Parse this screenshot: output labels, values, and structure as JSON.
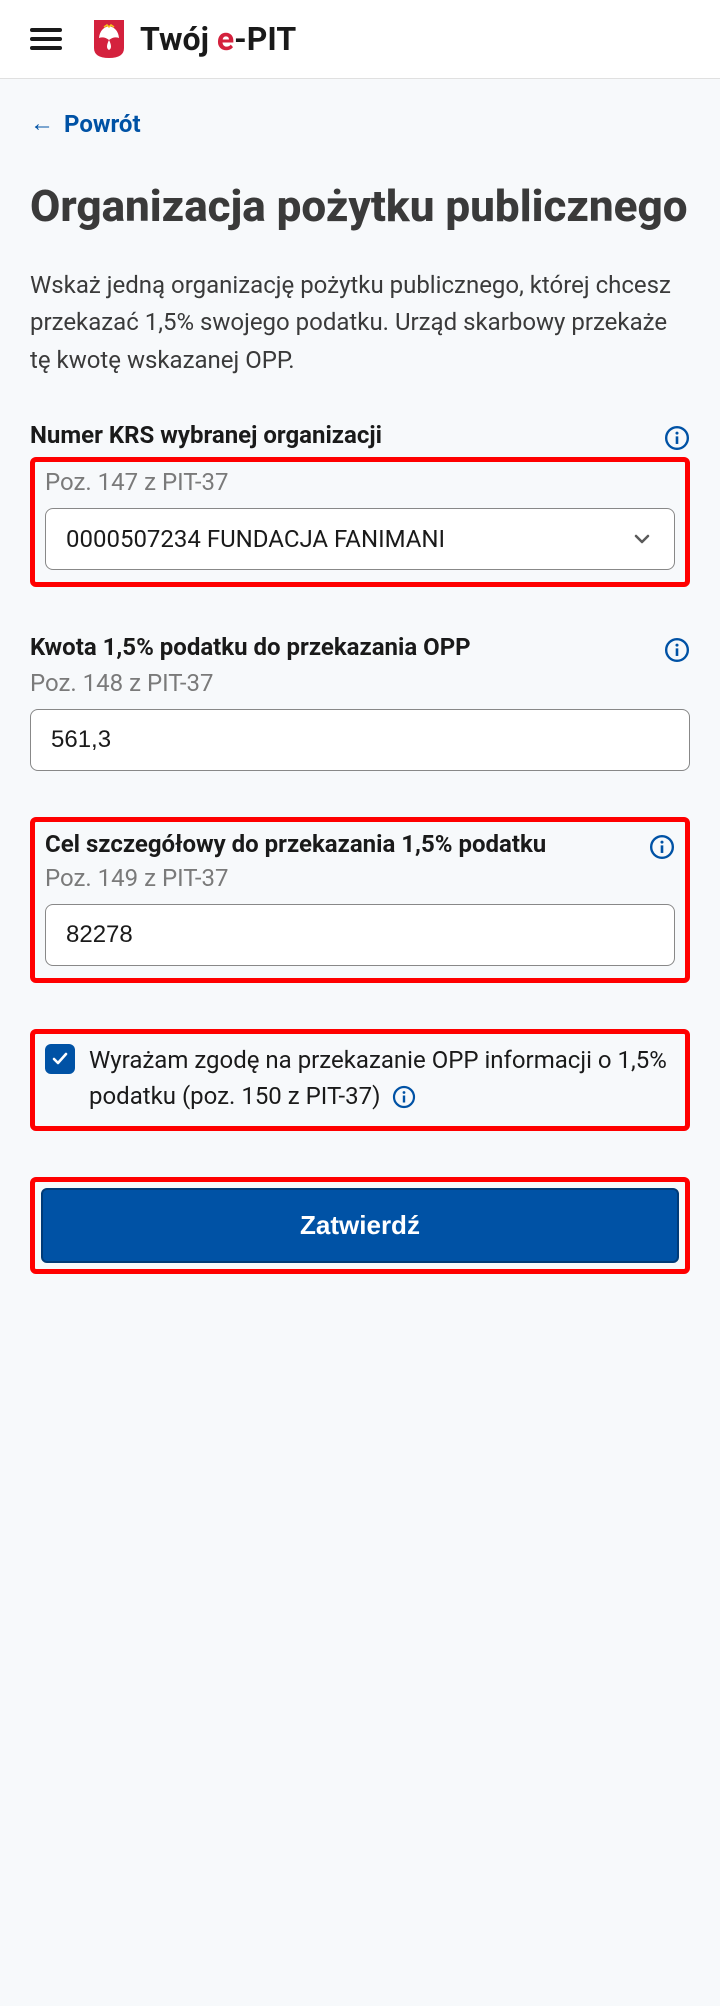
{
  "header": {
    "logo_main": "Twój ",
    "logo_accent": "e",
    "logo_suffix": "-PIT"
  },
  "back_label": "Powrót",
  "title": "Organizacja pożytku publicznego",
  "intro": "Wskaż jedną organizację pożytku publicznego, której chcesz przekazać 1,5% swojego podatku. Urząd skarbowy przekaże tę kwotę wskazanej OPP.",
  "krs": {
    "label": "Numer KRS wybranej organizacji",
    "caption": "Poz. 147 z PIT-37",
    "value": "0000507234 FUNDACJA FANIMANI"
  },
  "amount": {
    "label": "Kwota 1,5% podatku do przekazania OPP",
    "caption": "Poz. 148 z PIT-37",
    "value": "561,3"
  },
  "purpose": {
    "label": "Cel szczegółowy do przekazania 1,5% podatku",
    "caption": "Poz. 149 z PIT-37",
    "value": "82278"
  },
  "consent": {
    "text_1": "Wyrażam zgodę na przekazanie OPP informacji o 1,5% podatku (poz. 150 z PIT-37)"
  },
  "submit_label": "Zatwierdź"
}
